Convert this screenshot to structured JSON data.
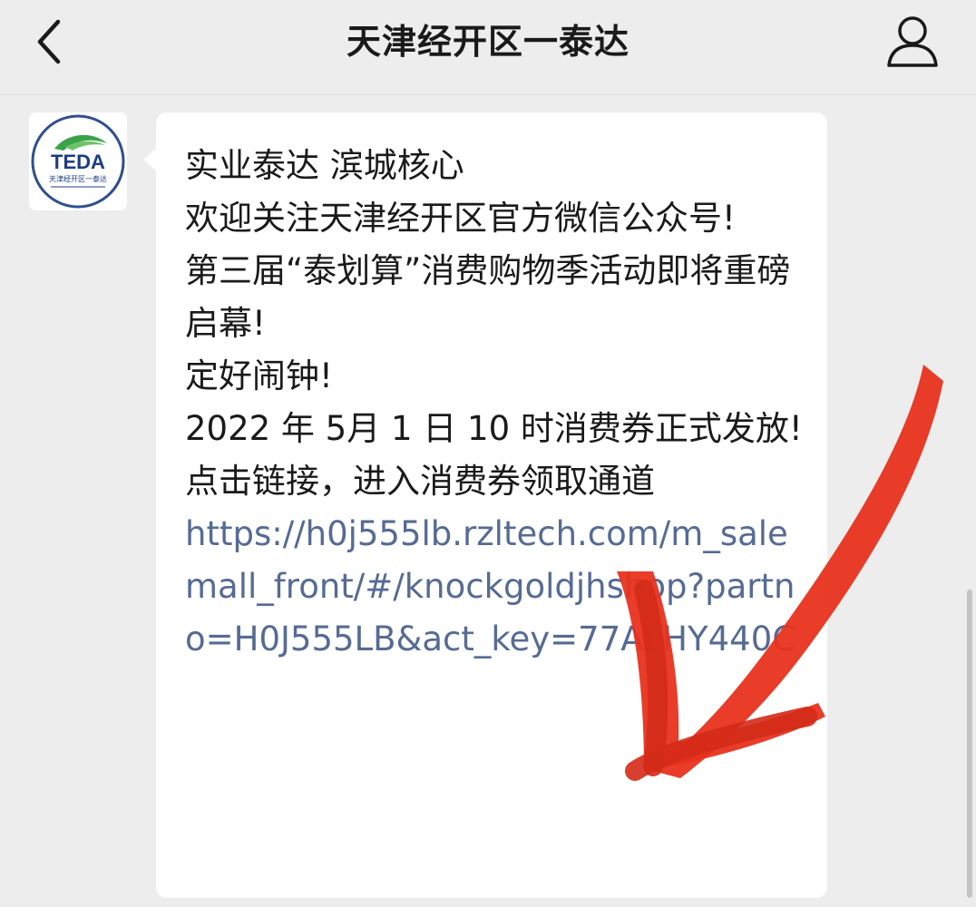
{
  "header": {
    "title": "天津经开区一泰达",
    "back_icon": "chevron-left-icon",
    "profile_icon": "person-icon"
  },
  "sender": {
    "avatar_logo_text": "TEDA",
    "avatar_logo_subtext": "天津经开区一泰达"
  },
  "message": {
    "lines": [
      "实业泰达 滨城核心",
      "欢迎关注天津经开区官方微信公众号!",
      "第三届“泰划算”消费购物季活动即将重磅启幕!",
      "定好闹钟!",
      "2022 年 5月 1 日 10 时消费券正式发放!",
      "点击链接，进入消费券领取通道"
    ],
    "link": "https://h0j555lb.rzltech.com/m_salemall_front/#/knockgoldjhshop?partno=H0J555LB&act_key=77ALHY440C"
  },
  "annotation": {
    "arrow_color": "#e8321e"
  },
  "colors": {
    "background": "#ededed",
    "bubble": "#ffffff",
    "link": "#566b94",
    "text": "#1a1a1a"
  }
}
